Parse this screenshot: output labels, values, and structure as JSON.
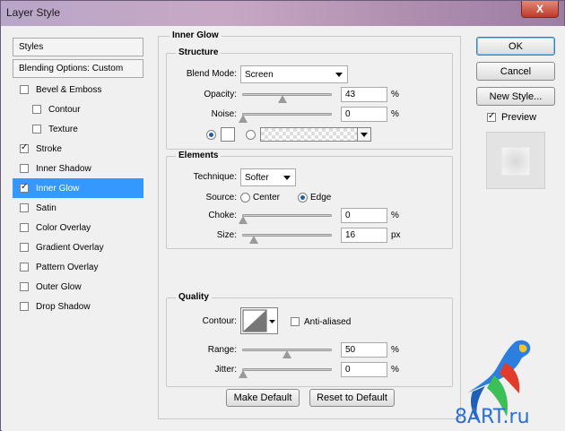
{
  "window": {
    "title": "Layer Style",
    "close_glyph": "X"
  },
  "sidebar": {
    "header": "Styles",
    "blending": "Blending Options: Custom",
    "items": [
      {
        "label": "Bevel & Emboss",
        "checked": false,
        "indent": false
      },
      {
        "label": "Contour",
        "checked": false,
        "indent": true
      },
      {
        "label": "Texture",
        "checked": false,
        "indent": true
      },
      {
        "label": "Stroke",
        "checked": true,
        "indent": false
      },
      {
        "label": "Inner Shadow",
        "checked": false,
        "indent": false
      },
      {
        "label": "Inner Glow",
        "checked": true,
        "indent": false,
        "selected": true
      },
      {
        "label": "Satin",
        "checked": false,
        "indent": false
      },
      {
        "label": "Color Overlay",
        "checked": false,
        "indent": false
      },
      {
        "label": "Gradient Overlay",
        "checked": false,
        "indent": false
      },
      {
        "label": "Pattern Overlay",
        "checked": false,
        "indent": false
      },
      {
        "label": "Outer Glow",
        "checked": false,
        "indent": false
      },
      {
        "label": "Drop Shadow",
        "checked": false,
        "indent": false
      }
    ]
  },
  "inner_glow": {
    "title": "Inner Glow",
    "structure": {
      "title": "Structure",
      "blend_mode_label": "Blend Mode:",
      "blend_mode_value": "Screen",
      "opacity_label": "Opacity:",
      "opacity_value": "43",
      "noise_label": "Noise:",
      "noise_value": "0",
      "percent": "%"
    },
    "elements": {
      "title": "Elements",
      "technique_label": "Technique:",
      "technique_value": "Softer",
      "source_label": "Source:",
      "source_center": "Center",
      "source_edge": "Edge",
      "choke_label": "Choke:",
      "choke_value": "0",
      "size_label": "Size:",
      "size_value": "16",
      "percent": "%",
      "px": "px"
    },
    "quality": {
      "title": "Quality",
      "contour_label": "Contour:",
      "anti_aliased": "Anti-aliased",
      "range_label": "Range:",
      "range_value": "50",
      "jitter_label": "Jitter:",
      "jitter_value": "0",
      "percent": "%"
    },
    "buttons": {
      "make_default": "Make Default",
      "reset_default": "Reset to Default"
    }
  },
  "actions": {
    "ok": "OK",
    "cancel": "Cancel",
    "new_style": "New Style...",
    "preview": "Preview"
  },
  "watermark": {
    "text": "8ART.ru"
  },
  "colors": {
    "selection": "#3399ff",
    "accent": "#3c7fb1"
  }
}
